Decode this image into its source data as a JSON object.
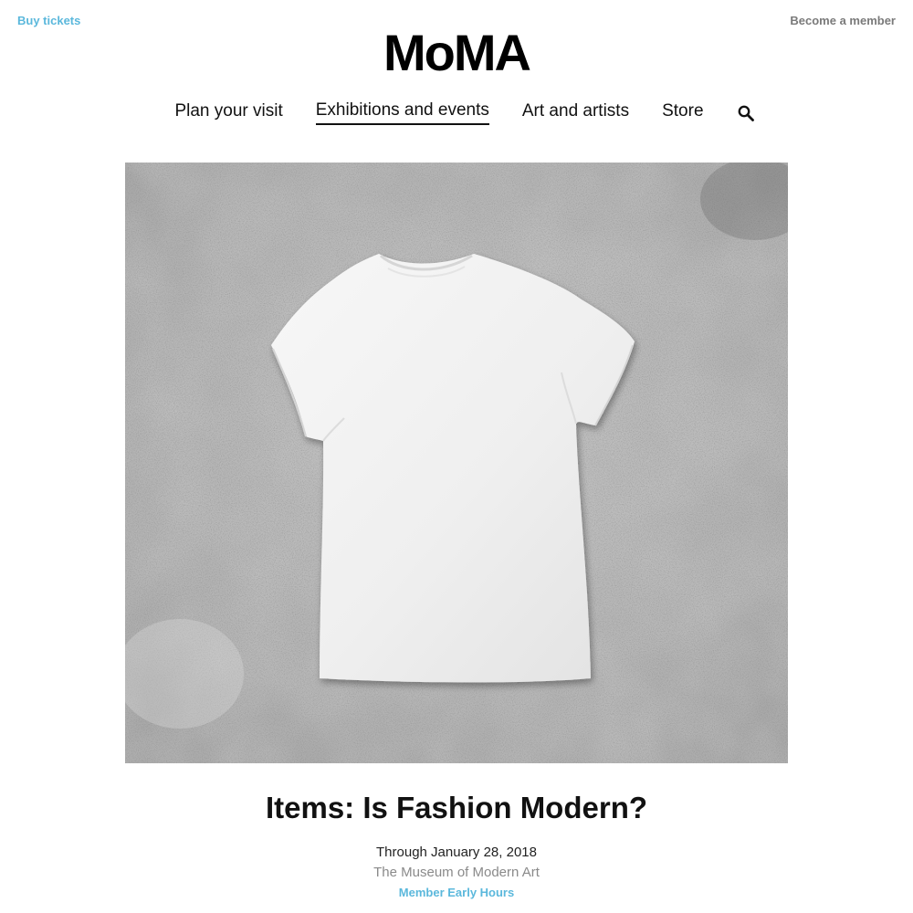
{
  "header": {
    "buy_tickets": "Buy tickets",
    "become_member": "Become a member",
    "logo": "MoMA"
  },
  "nav": {
    "items": [
      {
        "label": "Plan your visit",
        "active": false
      },
      {
        "label": "Exhibitions and events",
        "active": true
      },
      {
        "label": "Art and artists",
        "active": false
      },
      {
        "label": "Store",
        "active": false
      }
    ],
    "search_icon": "search-icon"
  },
  "hero": {
    "image": "white-tshirt-on-concrete"
  },
  "exhibition": {
    "title": "Items: Is Fashion Modern?",
    "date": "Through January 28, 2018",
    "venue": "The Museum of Modern Art",
    "cta": "Member Early Hours"
  },
  "colors": {
    "link_blue": "#5bb8dc",
    "muted_gray": "#7a7a7a",
    "text": "#111111"
  }
}
